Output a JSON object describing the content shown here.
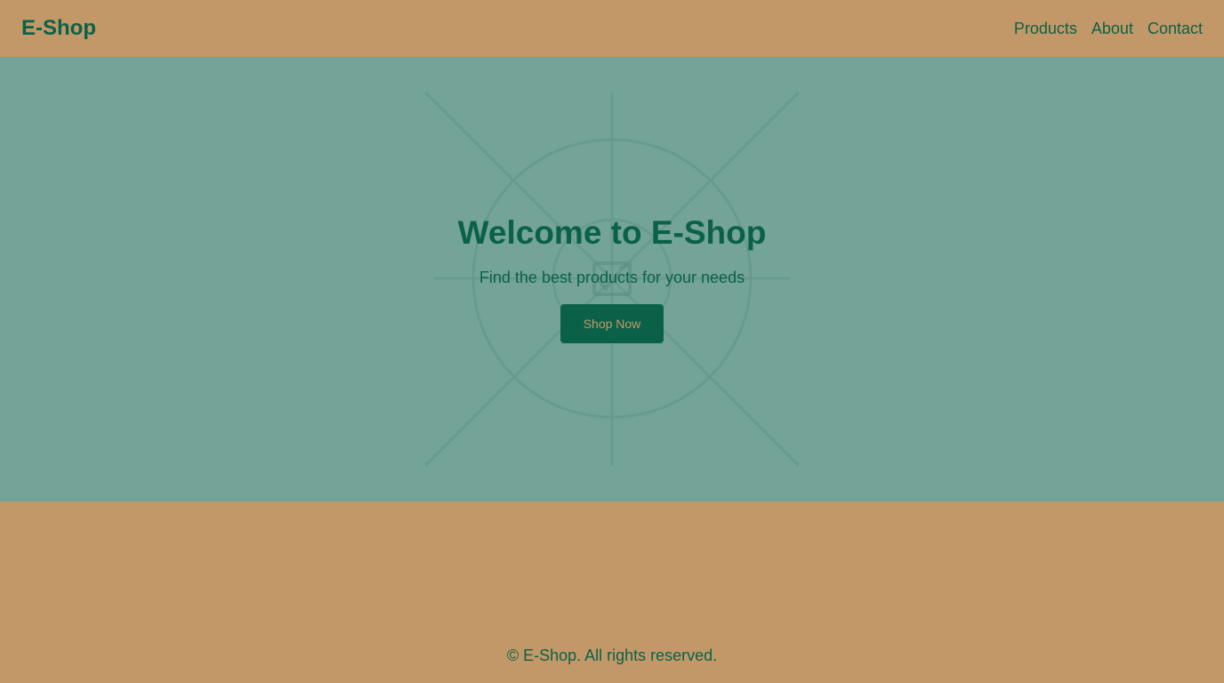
{
  "header": {
    "logo": "E-Shop",
    "nav": [
      {
        "label": "Products"
      },
      {
        "label": "About"
      },
      {
        "label": "Contact"
      }
    ]
  },
  "hero": {
    "title": "Welcome to E-Shop",
    "subtitle": "Find the best products for your needs",
    "cta_label": "Shop Now",
    "graphic_icon": "image-placeholder-icon"
  },
  "footer": {
    "text": "© E-Shop. All rights reserved."
  },
  "colors": {
    "background": "#c39868",
    "hero_background": "#74a497",
    "accent": "#0b6148"
  }
}
